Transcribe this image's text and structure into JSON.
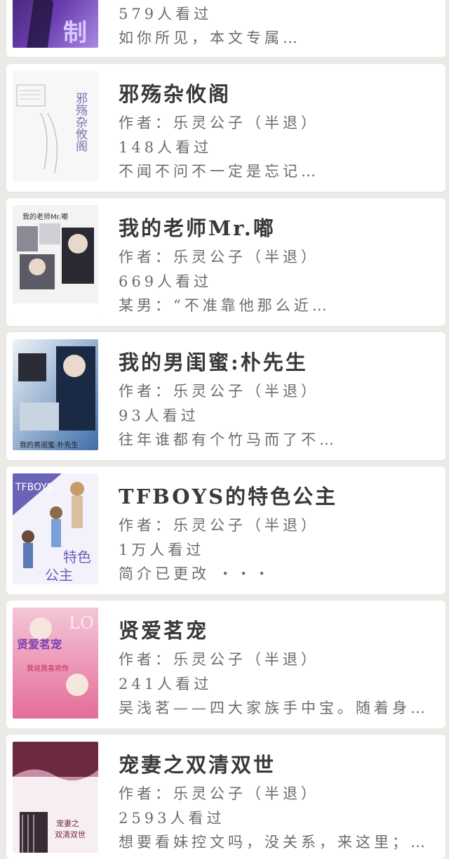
{
  "books": [
    {
      "title": "",
      "author": "",
      "views": "579人看过",
      "intro": "如你所见，本文专属…",
      "cover_text": "制",
      "cover_colors": [
        "#2b1b4d",
        "#6b3db0",
        "#a78be0"
      ]
    },
    {
      "title": "邪殇杂攸阁",
      "author": "作者：乐灵公子（半退）",
      "views": "148人看过",
      "intro": "不闻不问不一定是忘记…",
      "cover_text": "邪殇杂攸阁",
      "cover_colors": [
        "#f7f7f8",
        "#e8e8ee",
        "#7a6fb0"
      ]
    },
    {
      "title": "我的老师Mr.嘟",
      "author": "作者：乐灵公子（半退）",
      "views": "669人看过",
      "intro": "某男：“不准靠他那么近…",
      "cover_text": "我的老师Mr.嘟",
      "cover_colors": [
        "#f3f3f4",
        "#5c5a66",
        "#2a2a33"
      ]
    },
    {
      "title": "我的男闺蜜:朴先生",
      "author": "作者：乐灵公子（半退）",
      "views": "93人看过",
      "intro": "往年谁都有个竹马而了不…",
      "cover_text": "我的男闺蜜:朴先生",
      "cover_colors": [
        "#eef3f8",
        "#3f6ea8",
        "#1b2a44"
      ]
    },
    {
      "title": "TFBOYS的特色公主",
      "author": "作者：乐灵公子（半退）",
      "views": "1万人看过",
      "intro": "简介已更改        ・・・",
      "cover_text": "特色公主",
      "cover_colors": [
        "#f3f2fa",
        "#6a63b8",
        "#e7a1a8"
      ]
    },
    {
      "title": "贤爱茗宠",
      "author": "作者：乐灵公子（半退）",
      "views": "241人看过",
      "intro": "吴浅茗——四大家族手中宝。随着身…",
      "cover_text": "贤爱茗宠",
      "cover_colors": [
        "#f4c6d8",
        "#e56c98",
        "#7a3fb0"
      ]
    },
    {
      "title": "宠妻之双清双世",
      "author": "作者：乐灵公子（半退）",
      "views": "2593人看过",
      "intro": "想要看妹控文吗，没关系，来这里；…",
      "cover_text": "宠妻之双清双世",
      "cover_colors": [
        "#f7eef2",
        "#c98aa6",
        "#6b2a3e"
      ]
    }
  ]
}
